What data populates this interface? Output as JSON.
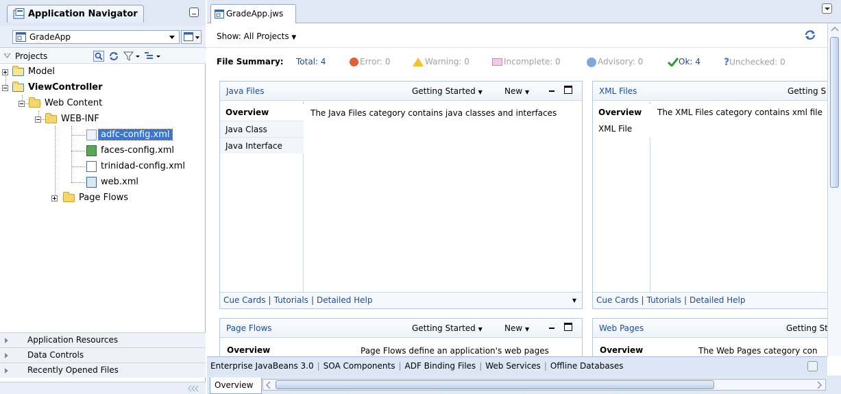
{
  "navigator": {
    "tab_title": "Application Navigator",
    "application": "GradeApp",
    "projects_label": "Projects",
    "tree": {
      "model": "Model",
      "view_controller": "ViewController",
      "web_content": "Web Content",
      "web_inf": "WEB-INF",
      "adfc_config": "adfc-config.xml",
      "faces_config": "faces-config.xml",
      "trinidad_config": "trinidad-config.xml",
      "web_xml": "web.xml",
      "page_flows": "Page Flows"
    },
    "accordions": [
      "Application Resources",
      "Data Controls",
      "Recently Opened Files"
    ]
  },
  "editor": {
    "tab_label": "GradeApp.jws",
    "show_label": "Show:",
    "show_value": "All Projects",
    "summary": {
      "label": "File Summary:",
      "total": "Total: 4",
      "error": "Error: 0",
      "warning": "Warning: 0",
      "incomplete": "Incomplete: 0",
      "advisory": "Advisory: 0",
      "ok": "Ok: 4",
      "unchecked": "Unchecked: 0"
    },
    "cards": {
      "java": {
        "title": "Java Files",
        "getting_started": "Getting Started",
        "new": "New",
        "tabs": [
          "Overview",
          "Java Class",
          "Java Interface"
        ],
        "description": "The Java Files category contains java classes and interfaces",
        "footer": [
          "Cue Cards",
          "Tutorials",
          "Detailed Help"
        ]
      },
      "xml": {
        "title": "XML Files",
        "getting_started": "Getting S",
        "tabs": [
          "Overview",
          "XML File"
        ],
        "description": "The XML Files category contains xml file",
        "footer": [
          "Cue Cards",
          "Tutorials",
          "Detailed Help"
        ]
      },
      "pageflows": {
        "title": "Page Flows",
        "getting_started": "Getting Started",
        "new": "New",
        "tabs": [
          "Overview"
        ],
        "description": "Page Flows define an application's web pages"
      },
      "webpages": {
        "title": "Web Pages",
        "getting_started": "Getting St",
        "tabs": [
          "Overview"
        ],
        "description": "The Web Pages category con"
      }
    },
    "categories": [
      "Enterprise JavaBeans 3.0",
      "SOA Components",
      "ADF Binding Files",
      "Web Services",
      "Offline Databases"
    ],
    "bottom_tab": "Overview"
  }
}
